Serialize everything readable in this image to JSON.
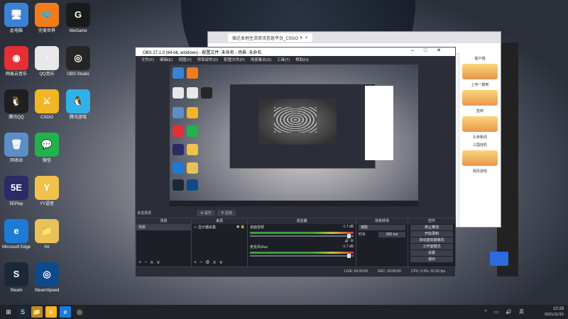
{
  "desktop": {
    "icons": [
      {
        "label": "此电脑",
        "icon": "computer-icon",
        "color": "#3b82d6",
        "glyph": "🖥"
      },
      {
        "label": "网易云音乐",
        "icon": "netease-music-icon",
        "color": "#e62f35",
        "glyph": "◉"
      },
      {
        "label": "腾讯QQ",
        "icon": "qq-icon",
        "color": "#1f1f1f",
        "glyph": "🐧"
      },
      {
        "label": "回收站",
        "icon": "recycle-bin-icon",
        "color": "#5d8fc7",
        "glyph": "🗑"
      },
      {
        "label": "5EPlay",
        "icon": "5e-icon",
        "color": "#2d2a66",
        "glyph": "5E"
      },
      {
        "label": "Microsoft Edge",
        "icon": "edge-icon",
        "color": "#1d7bd6",
        "glyph": "e"
      },
      {
        "label": "Steam",
        "icon": "steam-icon",
        "color": "#1b2838",
        "glyph": "S"
      }
    ],
    "icons_col2": [
      {
        "label": "完美世界",
        "icon": "perfect-world-icon",
        "color": "#f07c1e",
        "glyph": "🐦"
      },
      {
        "label": "QQ音乐",
        "icon": "qq-music-icon",
        "color": "#e8e8e8",
        "glyph": "♪"
      },
      {
        "label": "CSGO",
        "icon": "csgo-icon",
        "color": "#f2b524",
        "glyph": "⚔"
      },
      {
        "label": "微信",
        "icon": "wechat-icon",
        "color": "#22b24c",
        "glyph": "💬"
      },
      {
        "label": "YY语音",
        "icon": "yy-icon",
        "color": "#f0c14b",
        "glyph": "Y"
      },
      {
        "label": "Hz",
        "icon": "folder-icon",
        "color": "#e8c15a",
        "glyph": "📁"
      },
      {
        "label": "SteamSpeed",
        "icon": "speed-icon",
        "color": "#0e4a8a",
        "glyph": "◎"
      }
    ],
    "icons_col3": [
      {
        "label": "WeGame",
        "icon": "wegame-icon",
        "color": "#1a1a1a",
        "glyph": "G"
      },
      {
        "label": "OBS Studio",
        "icon": "obs-icon",
        "color": "#262626",
        "glyph": "◎"
      },
      {
        "label": "腾讯游戏",
        "icon": "tencent-game-icon",
        "color": "#30b2e8",
        "glyph": "🐧"
      }
    ]
  },
  "browser": {
    "tab_title": "宿迁本地生活资讯信息平台_CSGO",
    "side_panel": [
      "客户端",
      "上传一键到",
      "签到",
      "头条新闻",
      "三国挂机",
      "网页游戏"
    ]
  },
  "obs": {
    "title": "OBS 27.1.3 (64-bit, windows) - 配置文件: 未命名 - 场景: 未命名",
    "menu": [
      "文件(F)",
      "编辑(E)",
      "视图(V)",
      "停靠部件(D)",
      "配置文件(P)",
      "场景集合(S)",
      "工具(T)",
      "帮助(H)"
    ],
    "tabs": [
      "属性",
      "滤镜"
    ],
    "no_source": "未选择源",
    "docks": {
      "scenes": {
        "title": "场景",
        "items": [
          "场景"
        ]
      },
      "sources": {
        "title": "来源",
        "items": [
          "显示器采集"
        ]
      },
      "mixer": {
        "title": "混音器",
        "channels": [
          {
            "name": "桌面音频",
            "db": "-1.7 dB"
          },
          {
            "name": "麦克风/Aux",
            "db": "-1.7 dB"
          }
        ]
      },
      "transitions": {
        "title": "场景转场",
        "type": "渐隐",
        "duration_label": "时长",
        "duration": "300 ms"
      },
      "controls": {
        "title": "控件",
        "buttons": [
          "停止推流",
          "开始录制",
          "启动虚拟摄像机",
          "工作室模式",
          "设置",
          "退出"
        ]
      }
    },
    "status": {
      "live": "LIVE: 00:00:00",
      "rec": "REC: 00:00:00",
      "cpu": "CPU: 0.9%, 60.00 fps"
    }
  },
  "taskbar": {
    "apps": [
      {
        "icon": "start-icon",
        "glyph": "⊞",
        "color": "#1f2229"
      },
      {
        "icon": "steam-taskbar-icon",
        "glyph": "S",
        "color": "#1b2838"
      },
      {
        "icon": "explorer-icon",
        "glyph": "📁",
        "color": "#b58b2e"
      },
      {
        "icon": "csgo-taskbar-icon",
        "glyph": "⚔",
        "color": "#f2b524"
      },
      {
        "icon": "edge-taskbar-icon",
        "glyph": "e",
        "color": "#1d7bd6"
      },
      {
        "icon": "obs-taskbar-icon",
        "glyph": "◎",
        "color": "#262626"
      }
    ],
    "time": "10:28",
    "date": "2021/11/15"
  }
}
